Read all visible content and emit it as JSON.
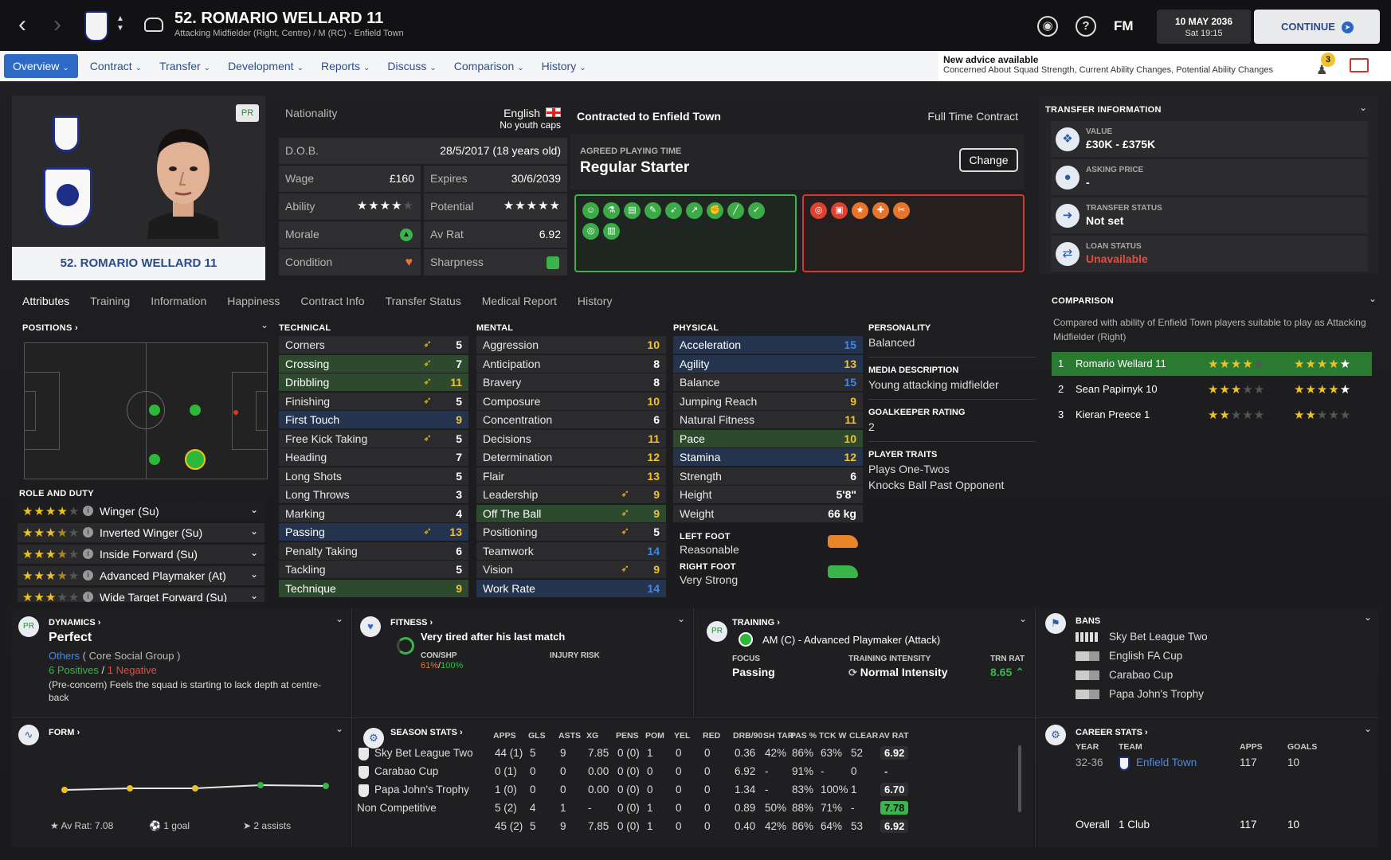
{
  "header": {
    "title": "52. ROMARIO WELLARD 11",
    "subtitle": "Attacking Midfielder (Right, Centre) / M (RC) - Enfield Town",
    "fm": "FM",
    "date": "10 MAY 2036",
    "time": "Sat 19:15",
    "continue": "CONTINUE"
  },
  "nav": {
    "items": [
      "Overview",
      "Contract",
      "Transfer",
      "Development",
      "Reports",
      "Discuss",
      "Comparison",
      "History"
    ],
    "active": "Overview"
  },
  "advice": {
    "title": "New advice available",
    "detail": "Concerned About Squad Strength, Current Ability Changes, Potential Ability Changes",
    "badge": "3"
  },
  "profile": {
    "name": "52. ROMARIO WELLARD 11",
    "badge": "PR"
  },
  "info": {
    "nationality_label": "Nationality",
    "nationality": "English",
    "youth_caps": "No youth caps",
    "dob_label": "D.O.B.",
    "dob": "28/5/2017 (18 years old)",
    "wage_label": "Wage",
    "wage": "£160",
    "expires_label": "Expires",
    "expires": "30/6/2039",
    "ability_label": "Ability",
    "potential_label": "Potential",
    "morale_label": "Morale",
    "avrat_label": "Av Rat",
    "avrat": "6.92",
    "condition_label": "Condition",
    "sharpness_label": "Sharpness"
  },
  "contract": {
    "title": "Contracted to Enfield Town",
    "type": "Full Time Contract",
    "apt_label": "AGREED PLAYING TIME",
    "apt_value": "Regular Starter",
    "change": "Change"
  },
  "subtabs": [
    "Attributes",
    "Training",
    "Information",
    "Happiness",
    "Contract Info",
    "Transfer Status",
    "Medical Report",
    "History"
  ],
  "transfer": {
    "title": "TRANSFER INFORMATION",
    "rows": [
      {
        "label": "VALUE",
        "value": "£30K - £375K",
        "color": "#ffffff"
      },
      {
        "label": "ASKING PRICE",
        "value": "-",
        "color": "#ffffff"
      },
      {
        "label": "TRANSFER STATUS",
        "value": "Not set",
        "color": "#ffffff"
      },
      {
        "label": "LOAN STATUS",
        "value": "Unavailable",
        "color": "#e84a3e"
      }
    ]
  },
  "comparison": {
    "title": "COMPARISON",
    "subtitle": "Compared with ability of Enfield Town players suitable to play as Attacking Midfielder (Right)",
    "rows": [
      {
        "rank": "1",
        "name": "Romario Wellard 11"
      },
      {
        "rank": "2",
        "name": "Sean Papirnyk 10"
      },
      {
        "rank": "3",
        "name": "Kieran Preece 1"
      }
    ]
  },
  "positions": {
    "title": "POSITIONS"
  },
  "role": {
    "title": "ROLE AND DUTY",
    "items": [
      "Winger (Su)",
      "Inverted Winger (Su)",
      "Inside Forward (Su)",
      "Advanced Playmaker (At)",
      "Wide Target Forward (Su)"
    ]
  },
  "technical": {
    "title": "TECHNICAL",
    "rows": [
      {
        "k": "Corners",
        "v": "5"
      },
      {
        "k": "Crossing",
        "v": "7"
      },
      {
        "k": "Dribbling",
        "v": "11"
      },
      {
        "k": "Finishing",
        "v": "5"
      },
      {
        "k": "First Touch",
        "v": "9"
      },
      {
        "k": "Free Kick Taking",
        "v": "5"
      },
      {
        "k": "Heading",
        "v": "7"
      },
      {
        "k": "Long Shots",
        "v": "5"
      },
      {
        "k": "Long Throws",
        "v": "3"
      },
      {
        "k": "Marking",
        "v": "4"
      },
      {
        "k": "Passing",
        "v": "13"
      },
      {
        "k": "Penalty Taking",
        "v": "6"
      },
      {
        "k": "Tackling",
        "v": "5"
      },
      {
        "k": "Technique",
        "v": "9"
      }
    ]
  },
  "mental": {
    "title": "MENTAL",
    "rows": [
      {
        "k": "Aggression",
        "v": "10"
      },
      {
        "k": "Anticipation",
        "v": "8"
      },
      {
        "k": "Bravery",
        "v": "8"
      },
      {
        "k": "Composure",
        "v": "10"
      },
      {
        "k": "Concentration",
        "v": "6"
      },
      {
        "k": "Decisions",
        "v": "11"
      },
      {
        "k": "Determination",
        "v": "12"
      },
      {
        "k": "Flair",
        "v": "13"
      },
      {
        "k": "Leadership",
        "v": "9"
      },
      {
        "k": "Off The Ball",
        "v": "9"
      },
      {
        "k": "Positioning",
        "v": "5"
      },
      {
        "k": "Teamwork",
        "v": "14"
      },
      {
        "k": "Vision",
        "v": "9"
      },
      {
        "k": "Work Rate",
        "v": "14"
      }
    ]
  },
  "physical": {
    "title": "PHYSICAL",
    "rows": [
      {
        "k": "Acceleration",
        "v": "15"
      },
      {
        "k": "Agility",
        "v": "13"
      },
      {
        "k": "Balance",
        "v": "15"
      },
      {
        "k": "Jumping Reach",
        "v": "9"
      },
      {
        "k": "Natural Fitness",
        "v": "11"
      },
      {
        "k": "Pace",
        "v": "10"
      },
      {
        "k": "Stamina",
        "v": "12"
      },
      {
        "k": "Strength",
        "v": "6"
      },
      {
        "k": "Height",
        "v": "5'8\""
      },
      {
        "k": "Weight",
        "v": "66 kg"
      }
    ],
    "left_foot_label": "LEFT FOOT",
    "left_foot": "Reasonable",
    "right_foot_label": "RIGHT FOOT",
    "right_foot": "Very Strong"
  },
  "personality": {
    "h1": "PERSONALITY",
    "v1": "Balanced",
    "h2": "MEDIA DESCRIPTION",
    "v2": "Young attacking midfielder",
    "h3": "GOALKEEPER RATING",
    "v3": "2",
    "h4": "PLAYER TRAITS",
    "traits": [
      "Plays One-Twos",
      "Knocks Ball Past Opponent"
    ]
  },
  "dynamics": {
    "title": "DYNAMICS",
    "value": "Perfect",
    "group": "Others",
    "group_sfx": "( Core Social Group )",
    "pos": "6 Positives",
    "sep": "/",
    "neg": "1 Negative",
    "note": "(Pre-concern) Feels the squad is starting to lack depth at centre-back"
  },
  "fitness": {
    "title": "FITNESS",
    "status": "Very tired after his last match",
    "con_label": "CON/SHP",
    "con": "61%",
    "sep": "/",
    "shp": "100%",
    "injury_label": "INJURY RISK"
  },
  "training": {
    "title": "TRAINING",
    "role": "AM (C) - Advanced Playmaker (Attack)",
    "focus_label": "FOCUS",
    "focus": "Passing",
    "int_label": "TRAINING INTENSITY",
    "intensity": "Normal Intensity",
    "trn_label": "TRN RAT",
    "trn": "8.65"
  },
  "bans": {
    "title": "BANS",
    "items": [
      "Sky Bet League Two",
      "English FA Cup",
      "Carabao Cup",
      "Papa John's Trophy"
    ]
  },
  "form": {
    "title": "FORM",
    "avrat": "Av Rat: 7.08",
    "goals": "1 goal",
    "assists": "2 assists"
  },
  "season": {
    "title": "SEASON STATS",
    "headers": [
      "APPS",
      "GLS",
      "ASTS",
      "XG",
      "PENS",
      "POM",
      "YEL",
      "RED",
      "DRB/90",
      "SH TAR",
      "PAS %",
      "TCK W",
      "CLEAR",
      "AV RAT"
    ],
    "rows": [
      {
        "comp": "Sky Bet League Two",
        "c": [
          "44 (1)",
          "5",
          "9",
          "7.85",
          "0 (0)",
          "1",
          "0",
          "0",
          "0.36",
          "42%",
          "86%",
          "63%",
          "52",
          "6.92"
        ]
      },
      {
        "comp": "Carabao Cup",
        "c": [
          "0 (1)",
          "0",
          "0",
          "0.00",
          "0 (0)",
          "0",
          "0",
          "0",
          "6.92",
          "-",
          "91%",
          "-",
          "0",
          "-"
        ]
      },
      {
        "comp": "Papa John's Trophy",
        "c": [
          "1 (0)",
          "0",
          "0",
          "0.00",
          "0 (0)",
          "0",
          "0",
          "0",
          "1.34",
          "-",
          "83%",
          "100%",
          "1",
          "6.70"
        ]
      },
      {
        "comp": "Non Competitive",
        "c": [
          "5 (2)",
          "4",
          "1",
          "-",
          "0 (0)",
          "1",
          "0",
          "0",
          "0.89",
          "50%",
          "88%",
          "71%",
          "-",
          "7.78"
        ]
      },
      {
        "comp": "",
        "c": [
          "45 (2)",
          "5",
          "9",
          "7.85",
          "0 (0)",
          "1",
          "0",
          "0",
          "0.40",
          "42%",
          "86%",
          "64%",
          "53",
          "6.92"
        ]
      }
    ]
  },
  "career": {
    "title": "CAREER STATS",
    "h_year": "YEAR",
    "h_team": "TEAM",
    "h_apps": "APPS",
    "h_goals": "GOALS",
    "year": "32-36",
    "team": "Enfield Town",
    "apps": "117",
    "goals": "10",
    "overall": "Overall",
    "clubs": "1 Club",
    "o_apps": "117",
    "o_goals": "10"
  },
  "chart_data": {
    "type": "line",
    "title": "",
    "x": [
      1,
      2,
      3,
      4,
      5
    ],
    "values": [
      6.6,
      6.7,
      6.7,
      6.9,
      6.85
    ],
    "ylim": [
      5,
      9
    ]
  }
}
